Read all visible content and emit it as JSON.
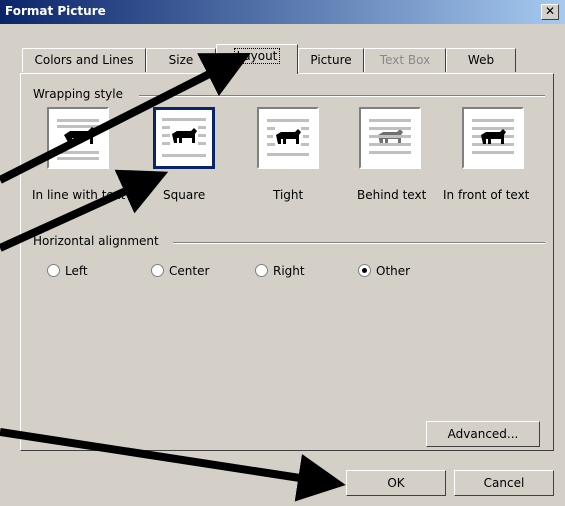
{
  "window": {
    "title": "Format Picture",
    "close_glyph": "✕"
  },
  "tabs": [
    {
      "label": "Colors and Lines",
      "state": "normal"
    },
    {
      "label": "Size",
      "state": "normal"
    },
    {
      "label": "Layout",
      "state": "active"
    },
    {
      "label": "Picture",
      "state": "normal"
    },
    {
      "label": "Text Box",
      "state": "disabled"
    },
    {
      "label": "Web",
      "state": "normal"
    }
  ],
  "wrapping": {
    "group_label": "Wrapping style",
    "options": [
      {
        "label": "In line with text",
        "selected": false,
        "icon": "inline-wrap-icon"
      },
      {
        "label": "Square",
        "selected": true,
        "icon": "square-wrap-icon"
      },
      {
        "label": "Tight",
        "selected": false,
        "icon": "tight-wrap-icon"
      },
      {
        "label": "Behind text",
        "selected": false,
        "icon": "behind-text-icon"
      },
      {
        "label": "In front of text",
        "selected": false,
        "icon": "in-front-of-text-icon"
      }
    ]
  },
  "alignment": {
    "group_label": "Horizontal alignment",
    "options": [
      {
        "label": "Left",
        "checked": false
      },
      {
        "label": "Center",
        "checked": false
      },
      {
        "label": "Right",
        "checked": false
      },
      {
        "label": "Other",
        "checked": true
      }
    ]
  },
  "buttons": {
    "advanced": "Advanced...",
    "ok": "OK",
    "cancel": "Cancel"
  },
  "colors": {
    "titlebar_start": "#0a246a",
    "titlebar_end": "#a6caf0",
    "dialog_bg": "#d4d0c8",
    "arrow": "#000000"
  }
}
